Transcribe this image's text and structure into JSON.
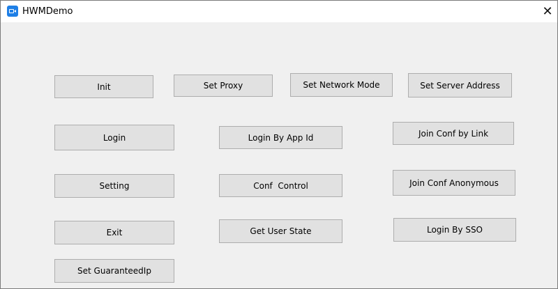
{
  "window": {
    "title": "HWMDemo",
    "close_glyph": "✕",
    "app_icon": "video-camera-icon"
  },
  "buttons": {
    "init": "Init",
    "set_proxy": "Set Proxy",
    "set_network_mode": "Set Network Mode",
    "set_server_address": "Set Server Address",
    "login": "Login",
    "login_by_app_id": "Login By App Id",
    "join_conf_by_link": "Join Conf by Link",
    "setting": "Setting",
    "conf_control": "Conf  Control",
    "join_conf_anonymous": "Join Conf Anonymous",
    "exit": "Exit",
    "get_user_state": "Get User State",
    "login_by_sso": "Login By SSO",
    "set_guaranteed_ip": "Set GuaranteedIp"
  },
  "colors": {
    "button_face": "#e1e1e1",
    "button_border": "#adadad",
    "window_bg": "#f0f0f0",
    "app_icon": "#1e7fe6"
  }
}
